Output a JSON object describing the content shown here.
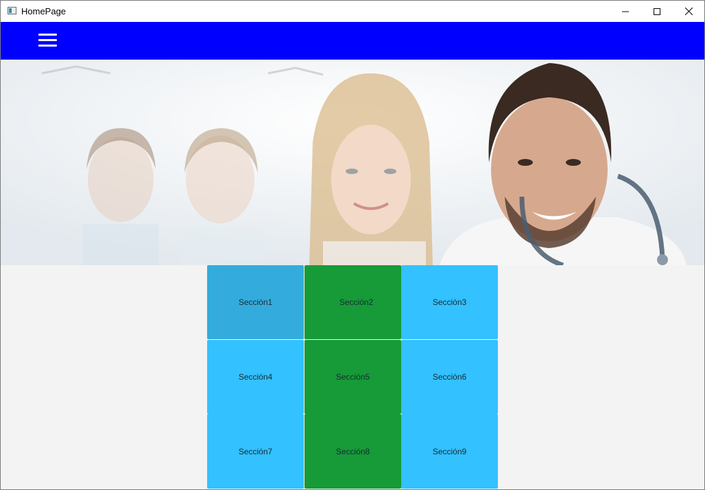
{
  "window": {
    "title": "HomePage"
  },
  "appbar": {
    "color": "#0000ff",
    "menu_icon": "hamburger-menu-icon"
  },
  "hero": {
    "description_icon": "doctors-banner-photo"
  },
  "sections": [
    {
      "label": "Sección1",
      "color": "#33acdd"
    },
    {
      "label": "Sección2",
      "color": "#169b38"
    },
    {
      "label": "Sección3",
      "color": "#33c1ff"
    },
    {
      "label": "Sección4",
      "color": "#33c1ff"
    },
    {
      "label": "Sección5",
      "color": "#169b38"
    },
    {
      "label": "Sección6",
      "color": "#33c1ff"
    },
    {
      "label": "Sección7",
      "color": "#33c1ff"
    },
    {
      "label": "Sección8",
      "color": "#169b38"
    },
    {
      "label": "Sección9",
      "color": "#33c1ff"
    }
  ]
}
